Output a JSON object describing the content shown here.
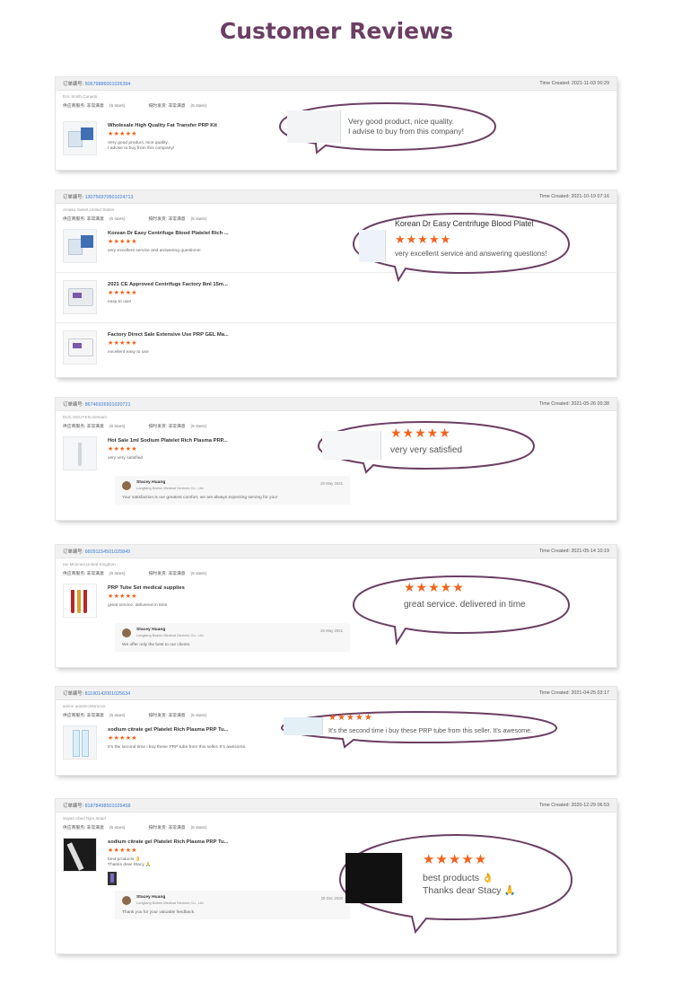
{
  "page": {
    "title": "Customer Reviews"
  },
  "labels": {
    "time_prefix": "Time Created:",
    "order_prefix": "订单编号:",
    "service_label": "供应商服务:",
    "shipping_label": "按时发货:",
    "rating_text": "非常满意",
    "rating_stars": "(5 stars)"
  },
  "reviews": [
    {
      "order_id": "5067988600102639​4",
      "time": "2021-11-03 00:29",
      "buyer": "Eric Smith,Canada",
      "items": [
        {
          "name": "Wholesale High Quality Fat Transfer PRP Kit",
          "stars": "★★★★★",
          "comment": "Very good product, nice quality.\nI advise to buy from this company!"
        }
      ],
      "bubble": {
        "stars": "",
        "text": "Very good product, nice quality.\nI advise to buy from this company!"
      }
    },
    {
      "order_id": "1307569705010247​13",
      "time": "2021-10-19 07:16",
      "buyer": "Amaka Sweet,United States",
      "items": [
        {
          "name": "Korean Dr Easy Centrifuge Blood Platelet Rich ...",
          "stars": "★★★★★",
          "comment": "very excellent service and answering questions!"
        },
        {
          "name": "2021 CE Approved Centrifuge Factory 8ml 15m...",
          "stars": "★★★★★",
          "comment": "easy to use!"
        },
        {
          "name": "Factory Direct Sale Extensive Use PRP GEL Ma...",
          "stars": "★★★★★",
          "comment": "excellent easy to use"
        }
      ],
      "bubble": {
        "title": "Korean Dr Easy Centrifuge Blood Platel",
        "stars": "★★★★★",
        "text": "very excellent service and answering questions!"
      }
    },
    {
      "order_id": "86746926501020721",
      "time": "2021-05-26 00:38",
      "buyer": "DUC NGUYEN,Vietnam",
      "items": [
        {
          "name": "Hot Sale 1ml Sodium Platelet Rich Plasma PRP...",
          "stars": "★★★★★",
          "comment": "very very satisfied"
        }
      ],
      "reply": {
        "name": "Stacey Huang",
        "company": "Langfang Baimu Medical Devices Co., Ltd.",
        "date": "20 May 2021",
        "text": "Your satisfaction is our greatest comfort, we are always expecting serving for you!"
      },
      "bubble": {
        "stars": "★★★★★",
        "text": "very very satisfied"
      }
    },
    {
      "order_id": "66091154501025849",
      "time": "2021-05-14 10:19",
      "buyer": "Ian Mcinnes,United Kingdom",
      "items": [
        {
          "name": "PRP Tube Set medical supplies",
          "stars": "★★★★★",
          "comment": "great service. delivered in time"
        }
      ],
      "reply": {
        "name": "Stacey Huang",
        "company": "Langfang Baimu Medical Devices Co., Ltd.",
        "date": "26 May 2021",
        "text": "We offer only the best to our clients."
      },
      "bubble": {
        "stars": "★★★★★",
        "text": "great service. delivered in time"
      }
    },
    {
      "order_id": "81190142001025634",
      "time": "2021-04-25 03:17",
      "buyer": "amine anasmi,Morocco",
      "items": [
        {
          "name": "sodium citrate gel Platelet Rich Plasma PRP Tu...",
          "stars": "★★★★★",
          "comment": "It's the second time i buy these PRP tube from this seller. It's awesome."
        }
      ],
      "bubble": {
        "stars": "★★★★★",
        "text": "It's the second time i buy these PRP tube from this seller. It's awesome."
      }
    },
    {
      "order_id": "81878498501026458",
      "time": "2020-12-29 06:53",
      "buyer": "Sayan Abed Nijm,Israel",
      "items": [
        {
          "name": "sodium citrate gel Platelet Rich Plasma PRP Tu...",
          "stars": "★★★★★",
          "comment": "best products 👌\nThanks dear Stacy 🙏"
        }
      ],
      "reply": {
        "name": "Stacey Huang",
        "company": "Langfang Baimu Medical Devices Co., Ltd.",
        "date": "29 Dec 2020",
        "text": "Thank you for your valuable feedback."
      },
      "bubble": {
        "stars": "★★★★★",
        "text": "best products 👌\nThanks dear Stacy 🙏"
      }
    }
  ]
}
